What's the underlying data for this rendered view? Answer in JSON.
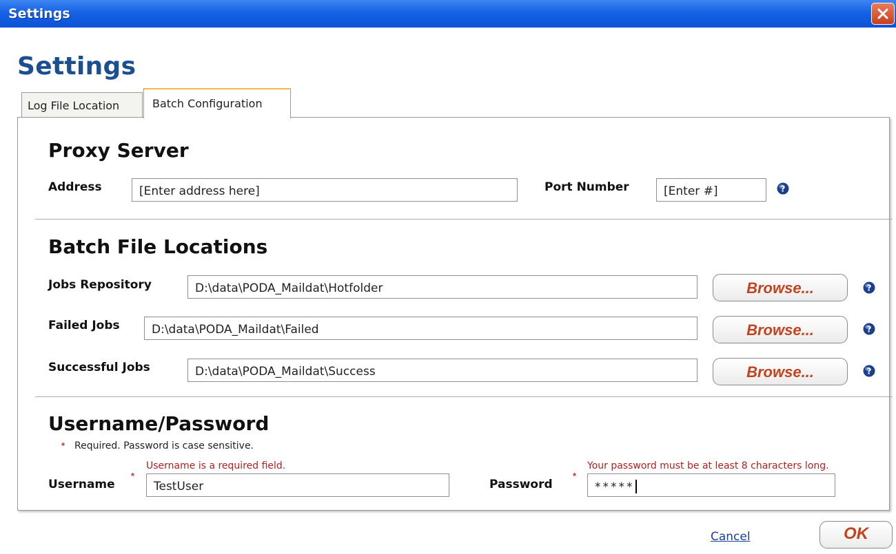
{
  "window": {
    "title": "Settings"
  },
  "page_title": "Settings",
  "tabs": [
    {
      "label": "Log File Location",
      "active": false
    },
    {
      "label": "Batch Configuration",
      "active": true
    }
  ],
  "proxy": {
    "heading": "Proxy Server",
    "address_label": "Address",
    "address_value": "[Enter address here]",
    "port_label": "Port Number",
    "port_value": "[Enter #]"
  },
  "batch": {
    "heading": "Batch File Locations",
    "browse_label": "Browse...",
    "rows": [
      {
        "label": "Jobs Repository",
        "value": "D:\\data\\PODA_Maildat\\Hotfolder"
      },
      {
        "label": "Failed Jobs",
        "value": "D:\\data\\PODA_Maildat\\Failed"
      },
      {
        "label": "Successful Jobs",
        "value": "D:\\data\\PODA_Maildat\\Success"
      }
    ]
  },
  "credentials": {
    "heading": "Username/Password",
    "required_star": "*",
    "required_note": "Required. Password is case sensitive.",
    "username_label": "Username",
    "username_value": "TestUser",
    "username_error": "Username is a required field.",
    "password_label": "Password",
    "password_value": "*****",
    "password_error": "Your password must be at least 8 characters long."
  },
  "footer": {
    "cancel_label": "Cancel",
    "ok_label": "OK"
  },
  "colors": {
    "title_bar": "#1662e4",
    "heading_blue": "#1c4f8f",
    "button_text": "#c4431f",
    "error_text": "#b21f1f"
  },
  "icons": {
    "close": "close-icon",
    "help": "help-icon"
  }
}
